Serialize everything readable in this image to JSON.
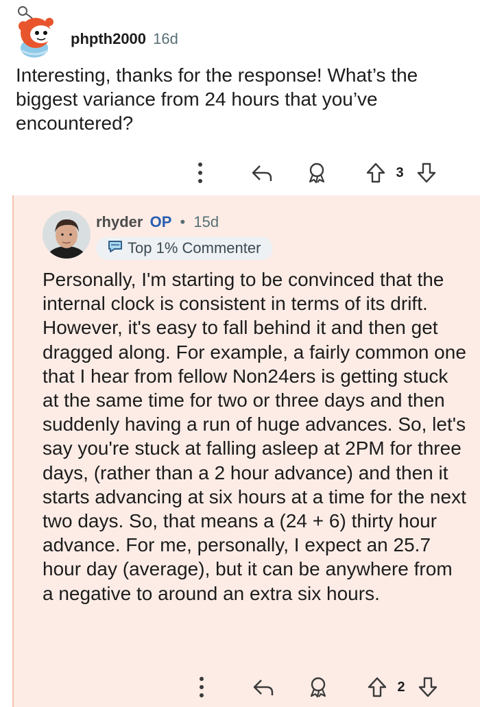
{
  "parent_comment": {
    "author": "phpth2000",
    "age": "16d",
    "body": "Interesting, thanks for the response! What’s the biggest variance from 24 hours that you’ve encountered?",
    "votes": "3",
    "avatar_icon": "snoo-avatar-icon"
  },
  "reply_comment": {
    "author": "rhyder",
    "op_tag": "OP",
    "separator": "•",
    "age": "15d",
    "badge": "Top 1% Commenter",
    "body": "Personally, I'm starting to be convinced that the internal clock is consistent in terms of its drift. However, it's easy to fall behind it and then get dragged along. For example, a fairly common one that I hear from fellow Non24ers is getting stuck at the same time for two or three days and then suddenly having a run of huge advances. So, let's say you're stuck at falling asleep at 2PM for three days, (rather than a 2 hour advance) and then it starts advancing at six hours at a time for the next two days. So, that means a (24 + 6) thirty hour advance. For me, personally, I expect an 25.7 hour day (average), but it can be anywhere from a negative to around an extra six hours.",
    "votes": "2",
    "avatar_icon": "user-photo-avatar"
  },
  "colors": {
    "reply_background": "#fdece6",
    "thread_line": "#f3c2ad",
    "op_blue": "#2a5db0",
    "text": "#1c1c1c",
    "muted": "#576f76"
  }
}
